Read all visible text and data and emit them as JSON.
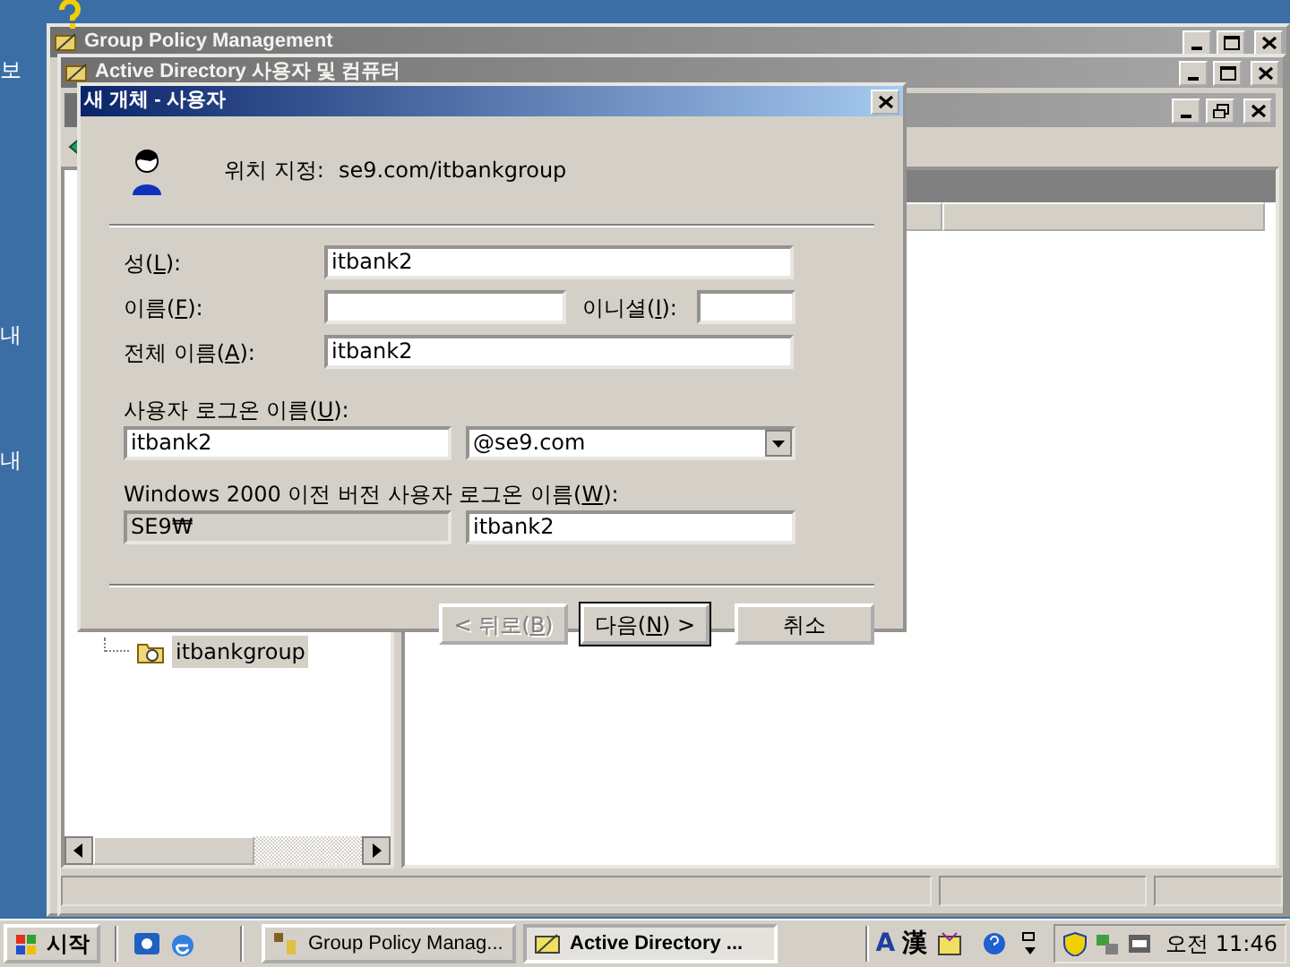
{
  "desktop_labels": [
    "보",
    "내",
    "내"
  ],
  "windows": [
    {
      "title": "Group Policy Management",
      "active": false
    },
    {
      "title": "Active Directory 사용자 및 컴퓨터",
      "active": false
    }
  ],
  "tree": {
    "items": [
      {
        "label": "itbankgroup",
        "selected": true
      }
    ]
  },
  "dialog": {
    "title": "새 개체 - 사용자",
    "active": true,
    "location_label": "위치 지정:",
    "location_value": "se9.com/itbankgroup",
    "last_name": {
      "label": "성(L):",
      "value": "itbank2"
    },
    "first_name": {
      "label": "이름(F):"
    },
    "initials": {
      "label": "이니셜(I):"
    },
    "full_name": {
      "label": "전체 이름(A):",
      "value": "itbank2"
    },
    "logon_name": {
      "label": "사용자 로그온 이름(U):",
      "value": "itbank2",
      "domain": "@se9.com"
    },
    "pre2000": {
      "label": "Windows 2000 이전 버전 사용자 로그온 이름(W):",
      "domain": "SE9₩",
      "domain_disabled": true,
      "value": "itbank2"
    },
    "buttons": [
      {
        "label": "< 뒤로(B)",
        "disabled": true,
        "default": false
      },
      {
        "label": "다음(N) >",
        "disabled": false,
        "default": true
      },
      {
        "label": "취소",
        "disabled": false,
        "default": false
      }
    ]
  },
  "taskbar": {
    "start": "시작",
    "tasks": [
      {
        "label": "Group Policy Manag...",
        "selected": false
      },
      {
        "label": "Active Directory ...",
        "selected": true
      }
    ],
    "ime": [
      "A",
      "漢"
    ],
    "clock": "오전 11:46"
  }
}
